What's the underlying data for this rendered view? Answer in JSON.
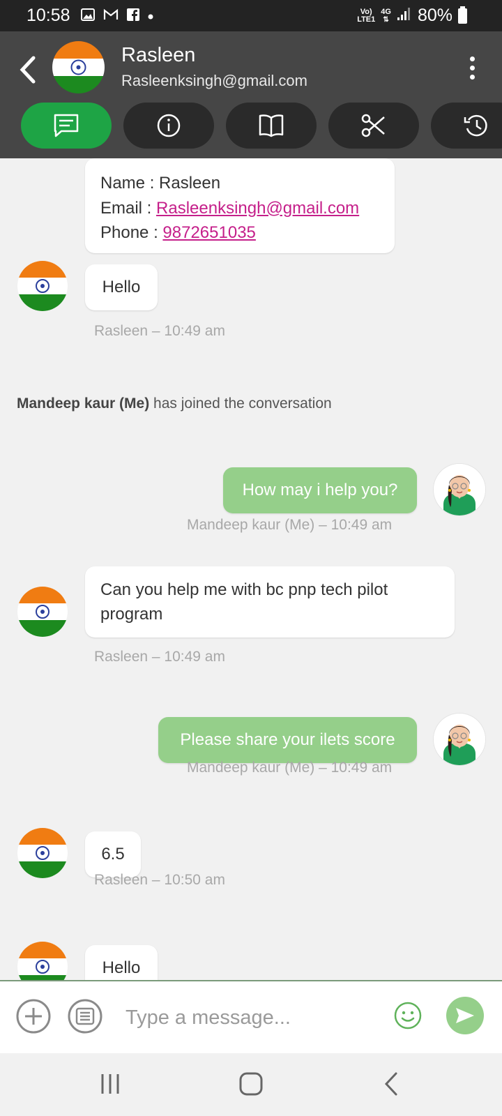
{
  "status_bar": {
    "time": "10:58",
    "net_top": "Vo)",
    "net_bottom": "LTE1",
    "net_4g": "4G",
    "battery": "80%"
  },
  "header": {
    "name": "Rasleen",
    "email": "Rasleenksingh@gmail.com",
    "tabs": [
      "chat-icon",
      "info-icon",
      "book-icon",
      "scissors-icon",
      "history-icon"
    ]
  },
  "contact_card": {
    "name_label": "Name : ",
    "name_value": "Rasleen",
    "email_label": "Email : ",
    "email_value": "Rasleenksingh@gmail.com",
    "phone_label": "Phone : ",
    "phone_value": "9872651035"
  },
  "messages": [
    {
      "text": "Hello",
      "meta": "Rasleen – 10:49 am"
    },
    {
      "text": "How may i help you?",
      "meta": "Mandeep kaur (Me) – 10:49 am"
    },
    {
      "text": "Can you help me with bc pnp tech pilot program",
      "meta": "Rasleen – 10:49 am"
    },
    {
      "text": "Please share your ilets score",
      "meta": "Mandeep kaur (Me) – 10:49 am"
    },
    {
      "text": "6.5",
      "meta": "Rasleen – 10:50 am"
    },
    {
      "text": "Hello",
      "meta": ""
    }
  ],
  "joined": {
    "who": "Mandeep kaur (Me)",
    "rest": " has joined the conversation"
  },
  "composer": {
    "placeholder": "Type a message..."
  },
  "colors": {
    "accent": "#1ea445",
    "my_bubble": "#95cf8a",
    "header": "#464646",
    "link": "#c51f8a"
  }
}
